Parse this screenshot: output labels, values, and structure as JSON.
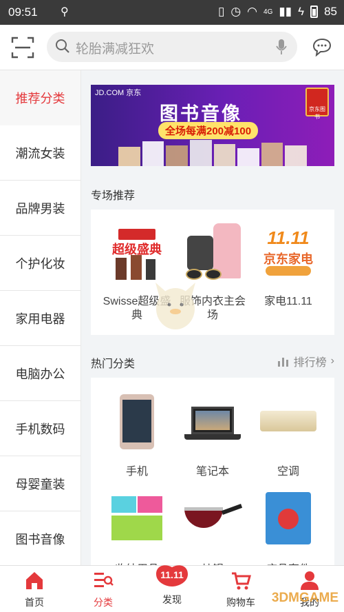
{
  "status_bar": {
    "time": "09:51",
    "network": "4G",
    "battery": "85"
  },
  "search": {
    "placeholder": "轮胎满减狂欢"
  },
  "sidebar": {
    "items": [
      {
        "label": "推荐分类",
        "active": true
      },
      {
        "label": "潮流女装",
        "active": false
      },
      {
        "label": "品牌男装",
        "active": false
      },
      {
        "label": "个护化妆",
        "active": false
      },
      {
        "label": "家用电器",
        "active": false
      },
      {
        "label": "电脑办公",
        "active": false
      },
      {
        "label": "手机数码",
        "active": false
      },
      {
        "label": "母婴童装",
        "active": false
      },
      {
        "label": "图书音像",
        "active": false
      }
    ]
  },
  "banner": {
    "brand": "JD.COM 京东",
    "title": "图书音像",
    "promo": "全场每满200减100",
    "badge": "京东图书"
  },
  "featured": {
    "title": "专场推荐",
    "items": [
      {
        "label": "Swisse超级盛典",
        "image_text": "超级盛典"
      },
      {
        "label": "服饰内衣主会场"
      },
      {
        "label": "家电11.11",
        "image_text": "京东家电"
      }
    ]
  },
  "hot": {
    "title": "热门分类",
    "ranking_label": "排行榜",
    "items": [
      {
        "label": "手机"
      },
      {
        "label": "笔记本"
      },
      {
        "label": "空调"
      },
      {
        "label": "收纳用品"
      },
      {
        "label": "炒锅"
      },
      {
        "label": "床品套件"
      }
    ]
  },
  "tabbar": {
    "items": [
      {
        "label": "首页",
        "active": false
      },
      {
        "label": "分类",
        "active": true
      },
      {
        "label": "发现",
        "active": false
      },
      {
        "label": "购物车",
        "active": false
      },
      {
        "label": "我的",
        "active": false
      }
    ]
  },
  "colors": {
    "accent": "#e4393c",
    "statusbar": "#3a3a3a",
    "banner": "#6a1fb5"
  },
  "watermark": "3DMGAME"
}
